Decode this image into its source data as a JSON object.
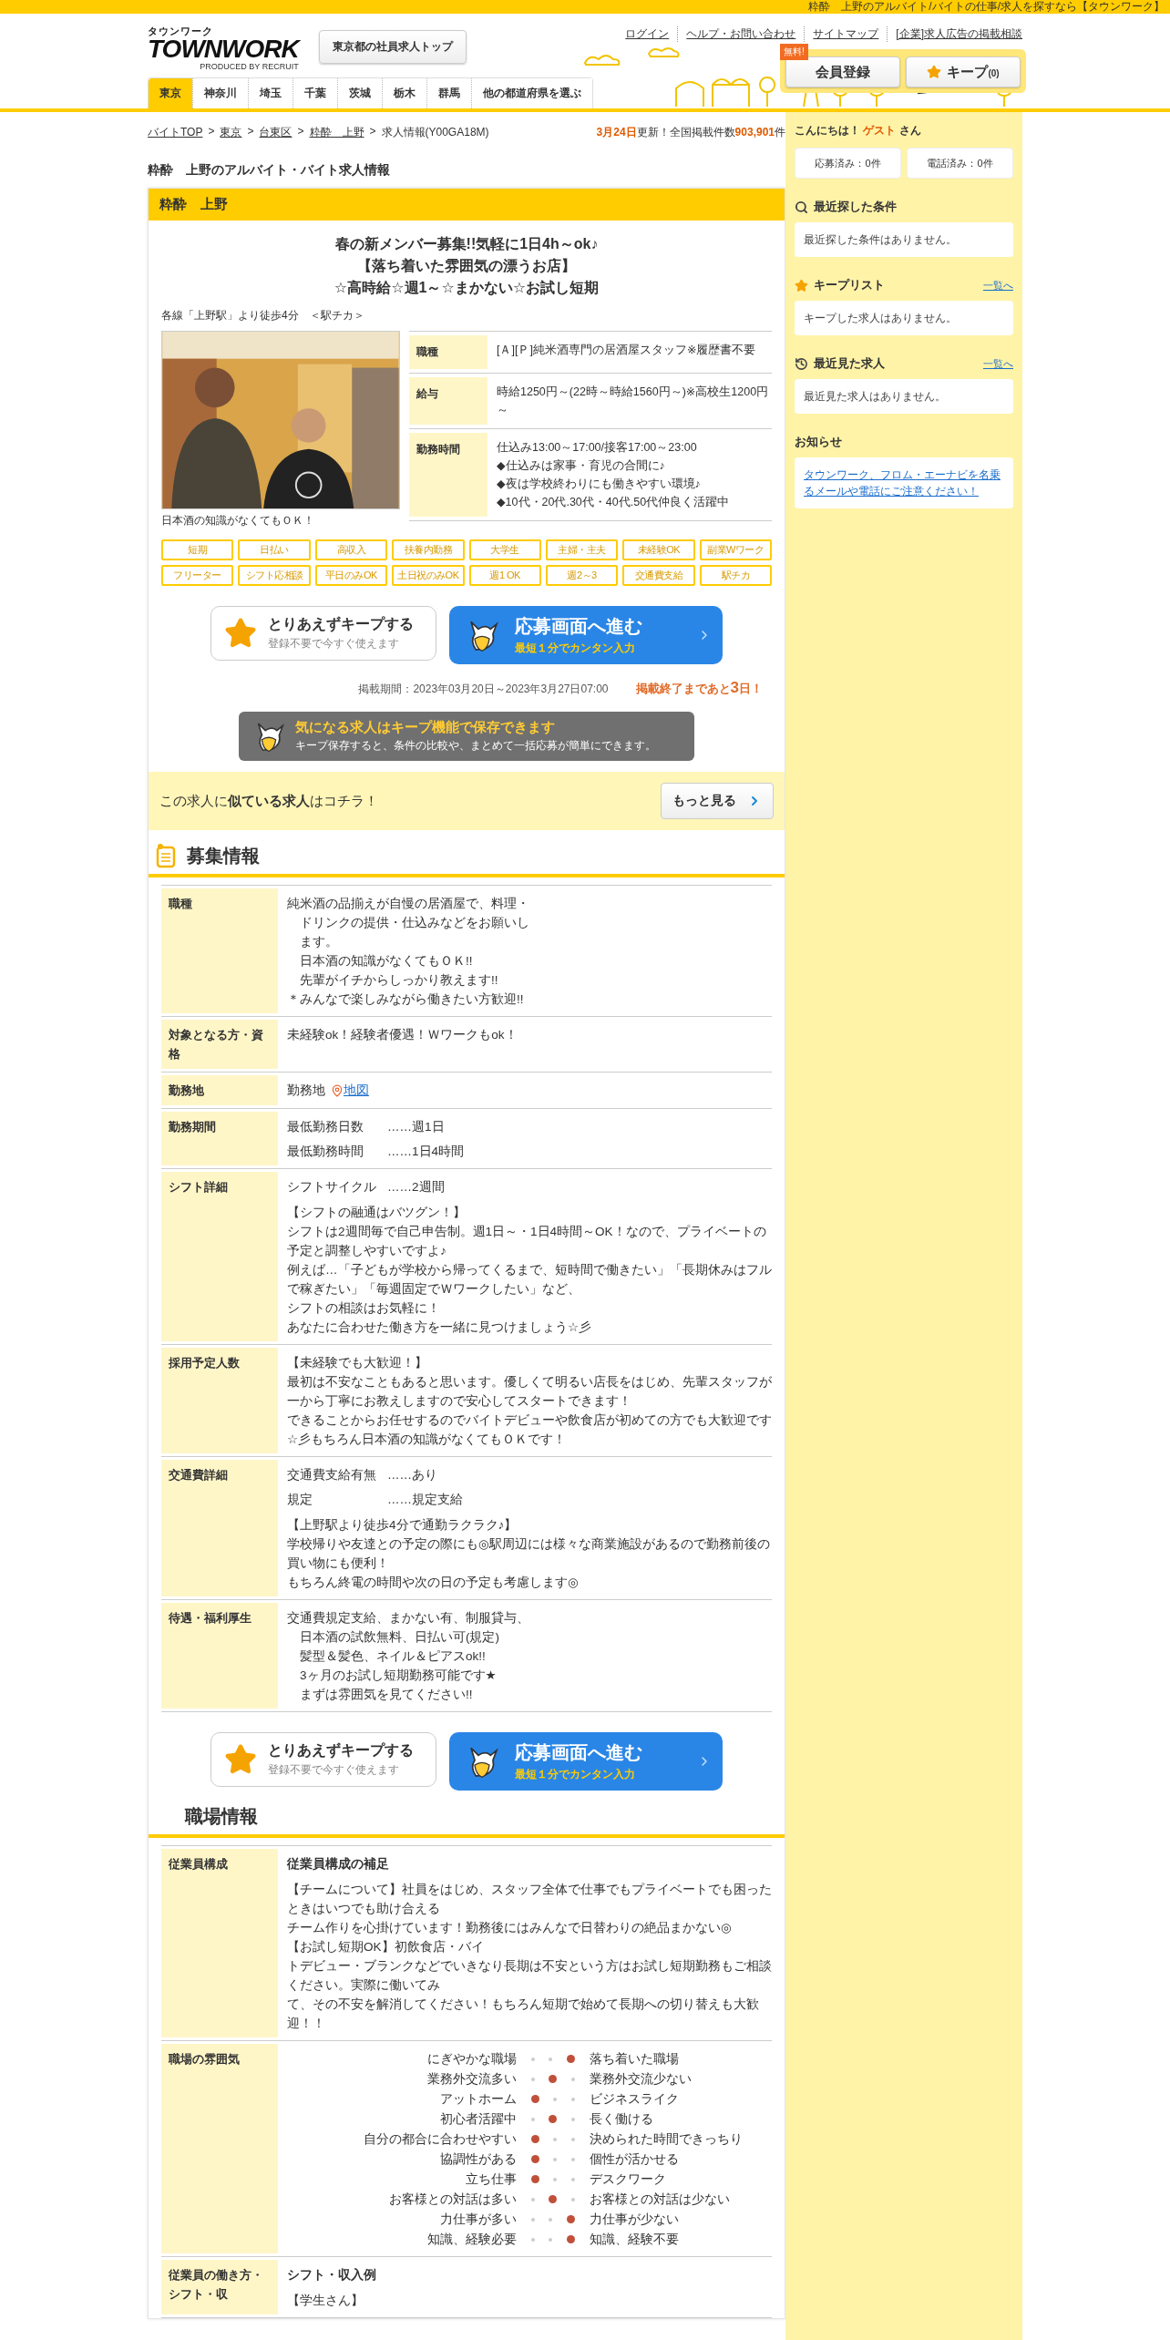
{
  "top_strip": "粋酔　上野のアルバイト/バイトの仕事/求人を探すなら【タウンワーク】",
  "header": {
    "logo": {
      "kana": "タウンワーク",
      "main": "TOWNWORK",
      "sub": "PRODUCED BY RECRUIT"
    },
    "corp_button": "東京都の社員求人トップ",
    "links": [
      "ログイン",
      "ヘルプ・お問い合わせ",
      "サイトマップ",
      "[企業]求人広告の掲載相談"
    ],
    "register": {
      "badge": "無料!",
      "label": "会員登録"
    },
    "keep": {
      "label": "キープ",
      "count": "(0)"
    },
    "tabs": [
      {
        "label": "東京",
        "selected": true
      },
      {
        "label": "神奈川",
        "selected": false
      },
      {
        "label": "埼玉",
        "selected": false
      },
      {
        "label": "千葉",
        "selected": false
      },
      {
        "label": "茨城",
        "selected": false
      },
      {
        "label": "栃木",
        "selected": false
      },
      {
        "label": "群馬",
        "selected": false
      },
      {
        "label": "他の都道府県を選ぶ",
        "selected": false
      }
    ]
  },
  "breadcrumb": {
    "separator": ">",
    "items": [
      "バイトTOP",
      "東京",
      "台東区",
      "粋酔　上野"
    ],
    "current": "求人情報(Y00GA18M)"
  },
  "update": {
    "date": "3月24日",
    "text": "更新！全国掲載件数",
    "count": "903,901",
    "unit": "件"
  },
  "page_title": "粋酔　上野のアルバイト・バイト求人情報",
  "job": {
    "shop": "粋酔　上野",
    "headline": [
      "春の新メンバー募集!!気軽に1日4h～ok♪",
      "【落ち着いた雰囲気の漂うお店】",
      "☆高時給☆週1～☆まかない☆お試し短期"
    ],
    "access": "各線「上野駅」より徒歩4分　＜駅チカ＞",
    "photo": {
      "caption": "日本酒の知識がなくてもＯＫ！"
    },
    "summary": [
      {
        "label": "職種",
        "lines": [
          "[Ａ][Ｐ]純米酒専門の居酒屋スタッフ※履歴書不要"
        ]
      },
      {
        "label": "給与",
        "lines": [
          "時給1250円～(22時～時給1560円～)※高校生1200円～"
        ]
      },
      {
        "label": "勤務時間",
        "lines": [
          "仕込み13:00～17:00/接客17:00～23:00",
          "◆仕込みは家事・育児の合間に♪",
          "◆夜は学校終わりにも働きやすい環境♪",
          "◆10代・20代.30代・40代.50代仲良く活躍中"
        ]
      }
    ],
    "tags": [
      "短期",
      "日払い",
      "高収入",
      "扶養内勤務",
      "大学生",
      "主婦・主夫",
      "未経験OK",
      "副業Wワーク",
      "フリーター",
      "シフト応相談",
      "平日のみOK",
      "土日祝のみOK",
      "週1 OK",
      "週2～3",
      "交通費支給",
      "駅チカ"
    ],
    "buttons": {
      "keep": {
        "title": "とりあえずキープする",
        "sub": "登録不要で今すぐ使えます"
      },
      "apply": {
        "title": "応募画面へ進む",
        "sub": "最短１分でカンタン入力"
      }
    },
    "period": "掲載期間：2023年03月20日～2023年3月27日07:00",
    "deadline": {
      "text": "掲載終了まであと",
      "days": "3",
      "unit": "日！"
    },
    "keep_banner": {
      "title": "気になる求人はキープ機能で保存できます",
      "sub": "キープ保存すると、条件の比較や、まとめて一括応募が簡単にできます。"
    },
    "similar": {
      "text": "この求人に**似ている求人**はコチラ！",
      "button": "もっと見る"
    }
  },
  "recruit": {
    "title": "募集情報",
    "rows": [
      {
        "label": "職種",
        "blocks": [
          {
            "kind": "text",
            "lines": [
              "純米酒の品揃えが自慢の居酒屋で、料理・",
              "　ドリンクの提供・仕込みなどをお願いし",
              "　ます。",
              "　日本酒の知識がなくてもＯＫ!!",
              "　先輩がイチからしっかり教えます!!",
              "＊みんなで楽しみながら働きたい方歓迎!!"
            ]
          }
        ]
      },
      {
        "label": "対象となる方・資格",
        "blocks": [
          {
            "kind": "text",
            "lines": [
              "未経験ok！経験者優遇！Ｗワークもok！"
            ]
          }
        ]
      },
      {
        "label": "勤務地",
        "blocks": [
          {
            "kind": "location",
            "text": "勤務地",
            "link": "地図"
          }
        ]
      },
      {
        "label": "勤務期間",
        "blocks": [
          {
            "kind": "pairs",
            "items": [
              {
                "key": "最低勤務日数",
                "value": "……週1日"
              },
              {
                "key": "最低勤務時間",
                "value": "……1日4時間"
              }
            ]
          }
        ]
      },
      {
        "label": "シフト詳細",
        "blocks": [
          {
            "kind": "pairs",
            "items": [
              {
                "key": "シフトサイクル",
                "value": "……2週間"
              }
            ]
          },
          {
            "kind": "text",
            "lines": [
              "【シフトの融通はバツグン！】",
              "シフトは2週間毎で自己申告制。週1日～・1日4時間～OK！なので、プライベートの予定と調整しやすいですよ♪",
              "例えば…「子どもが学校から帰ってくるまで、短時間で働きたい」「長期休みはフルで稼ぎたい」「毎週固定でＷワークしたい」など、",
              "シフトの相談はお気軽に！",
              "あなたに合わせた働き方を一緒に見つけましょう☆彡"
            ]
          }
        ]
      },
      {
        "label": "採用予定人数",
        "blocks": [
          {
            "kind": "text",
            "lines": [
              "【未経験でも大歓迎！】",
              "最初は不安なこともあると思います。優しくて明るい店長をはじめ、先輩スタッフが一から丁寧にお教えしますので安心してスタートできます！",
              "できることからお任せするのでバイトデビューや飲食店が初めての方でも大歓迎です☆彡もちろん日本酒の知識がなくてもＯＫです！"
            ]
          }
        ]
      },
      {
        "label": "交通費詳細",
        "blocks": [
          {
            "kind": "pairs",
            "items": [
              {
                "key": "交通費支給有無",
                "value": "……あり"
              },
              {
                "key": "規定",
                "value": "……規定支給"
              }
            ]
          },
          {
            "kind": "text",
            "lines": [
              "【上野駅より徒歩4分で通勤ラクラク♪】",
              "学校帰りや友達との予定の際にも◎駅周辺には様々な商業施設があるので勤務前後の買い物にも便利！",
              "もちろん終電の時間や次の日の予定も考慮します◎"
            ]
          }
        ]
      },
      {
        "label": "待遇・福利厚生",
        "blocks": [
          {
            "kind": "text",
            "lines": [
              "交通費規定支給、まかない有、制服貸与、",
              "　日本酒の試飲無料、日払い可(規定)",
              "　髪型＆髪色、ネイル＆ピアスok!!",
              "　3ヶ月のお試し短期勤務可能です★",
              "　まずは雰囲気を見てください!!"
            ]
          }
        ]
      }
    ],
    "buttons": {
      "keep": {
        "title": "とりあえずキープする",
        "sub": "登録不要で今すぐ使えます"
      },
      "apply": {
        "title": "応募画面へ進む",
        "sub": "最短１分でカンタン入力"
      }
    }
  },
  "workplace": {
    "title": "職場情報",
    "rows": [
      {
        "label": "従業員構成",
        "blocks": [
          {
            "kind": "heading",
            "text": "従業員構成の補足"
          },
          {
            "kind": "text",
            "lines": [
              "【チームについて】社員をはじめ、スタッフ全体で仕事でもプライベートでも困ったときはいつでも助け合える",
              "チーム作りを心掛けています！勤務後にはみんなで日替わりの絶品まかない◎",
              "【お試し短期OK】初飲食店・バイ",
              "トデビュー・ブランクなどでいきなり長期は不安という方はお試し短期勤務もご相談ください。実際に働いてみ",
              "て、その不安を解消してください！もちろん短期で始めて長期への切り替えも大歓迎！！"
            ]
          }
        ]
      },
      {
        "label": "職場の雰囲気",
        "blocks": [
          {
            "kind": "scales",
            "items": [
              {
                "left": "にぎやかな職場",
                "right": "落ち着いた職場",
                "dots": [
                  {
                    "selected": false
                  },
                  {
                    "selected": false
                  },
                  {
                    "selected": true
                  }
                ]
              },
              {
                "left": "業務外交流多い",
                "right": "業務外交流少ない",
                "dots": [
                  {
                    "selected": false
                  },
                  {
                    "selected": true
                  },
                  {
                    "selected": false
                  }
                ]
              },
              {
                "left": "アットホーム",
                "right": "ビジネスライク",
                "dots": [
                  {
                    "selected": true
                  },
                  {
                    "selected": false
                  },
                  {
                    "selected": false
                  }
                ]
              },
              {
                "left": "初心者活躍中",
                "right": "長く働ける",
                "dots": [
                  {
                    "selected": false
                  },
                  {
                    "selected": true
                  },
                  {
                    "selected": false
                  }
                ]
              },
              {
                "left": "自分の都合に合わせやすい",
                "right": "決められた時間できっちり",
                "dots": [
                  {
                    "selected": true
                  },
                  {
                    "selected": false
                  },
                  {
                    "selected": false
                  }
                ]
              },
              {
                "left": "協調性がある",
                "right": "個性が活かせる",
                "dots": [
                  {
                    "selected": true
                  },
                  {
                    "selected": false
                  },
                  {
                    "selected": false
                  }
                ]
              },
              {
                "left": "立ち仕事",
                "right": "デスクワーク",
                "dots": [
                  {
                    "selected": true
                  },
                  {
                    "selected": false
                  },
                  {
                    "selected": false
                  }
                ]
              },
              {
                "left": "お客様との対話は多い",
                "right": "お客様との対話は少ない",
                "dots": [
                  {
                    "selected": false
                  },
                  {
                    "selected": true
                  },
                  {
                    "selected": false
                  }
                ]
              },
              {
                "left": "力仕事が多い",
                "right": "力仕事が少ない",
                "dots": [
                  {
                    "selected": false
                  },
                  {
                    "selected": false
                  },
                  {
                    "selected": true
                  }
                ]
              },
              {
                "left": "知識、経験必要",
                "right": "知識、経験不要",
                "dots": [
                  {
                    "selected": false
                  },
                  {
                    "selected": false
                  },
                  {
                    "selected": true
                  }
                ]
              }
            ]
          }
        ]
      },
      {
        "label": "従業員の働き方・シフト・収",
        "blocks": [
          {
            "kind": "heading",
            "text": "シフト・収入例"
          },
          {
            "kind": "text",
            "lines": [
              "【学生さん】"
            ]
          }
        ]
      }
    ]
  },
  "sidebar": {
    "greeting": {
      "before": "こんにちは！",
      "name": "ゲスト",
      "after": "さん"
    },
    "counts": [
      "応募済み：0件",
      "電話済み：0件"
    ],
    "sections": [
      {
        "kind": "search",
        "title": "最近探した条件",
        "message": "最近探した条件はありません。"
      },
      {
        "kind": "keep",
        "title": "キープリスト",
        "link": "一覧へ",
        "message": "キープした求人はありません。"
      },
      {
        "kind": "history",
        "title": "最近見た求人",
        "link": "一覧へ",
        "message": "最近見た求人はありません。"
      },
      {
        "kind": "notice",
        "title": "お知らせ",
        "notice_link": "タウンワーク、フロム・エーナビを名乗るメールや電話にご注意ください！"
      }
    ]
  }
}
